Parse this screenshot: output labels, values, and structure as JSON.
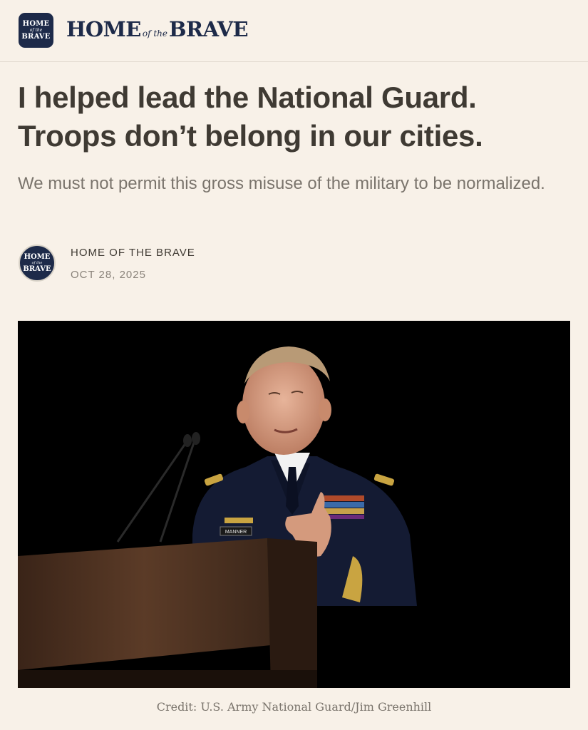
{
  "brand": {
    "logo_line1": "HOME",
    "logo_line2": "of the",
    "logo_line3": "BRAVE",
    "wordmark_home": "HOME",
    "wordmark_ofthe": "of the",
    "wordmark_brave": "BRAVE",
    "navy": "#1d2a49"
  },
  "article": {
    "title": "I helped lead the National Guard. Troops don’t belong in our cities.",
    "subtitle": "We must not permit this gross misuse of the military to be normalized.",
    "author": "HOME OF THE BRAVE",
    "date": "OCT 28, 2025",
    "image_caption": "Credit: U.S. Army National Guard/Jim Greenhill",
    "image_nameplate": "MANNER"
  },
  "colors": {
    "background": "#f8f1e8",
    "headline": "#3f3a33",
    "muted": "#7a746c"
  }
}
